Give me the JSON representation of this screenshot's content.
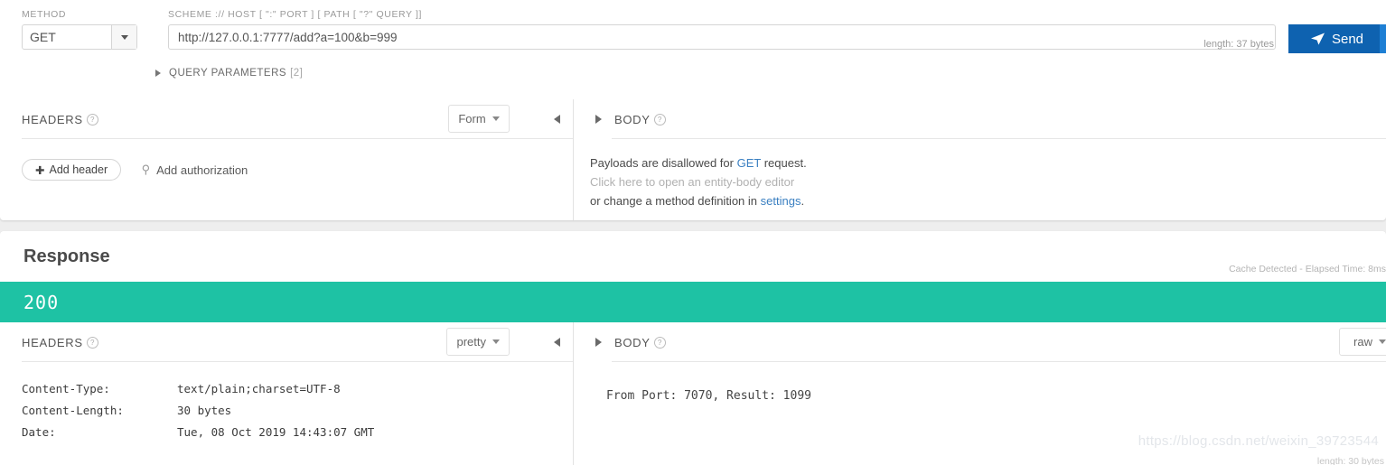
{
  "request": {
    "method_label": "METHOD",
    "method_value": "GET",
    "url_label": "SCHEME :// HOST [ \":\" PORT ] [ PATH [ \"?\" QUERY ]]",
    "url_value": "http://127.0.0.1:7777/add?a=100&b=999",
    "url_length": "length: 37 bytes",
    "query_params_label": "QUERY PARAMETERS",
    "query_params_count": "[2]",
    "send_label": "Send",
    "send_icon": "paper-plane-icon",
    "headers": {
      "title": "HEADERS",
      "help": "?",
      "format_value": "Form",
      "add_header_label": "Add header",
      "add_header_icon": "plus-icon",
      "add_authorization_label": "Add authorization",
      "add_authorization_icon": "key-icon"
    },
    "body": {
      "title": "BODY",
      "help": "?",
      "line1_a": "Payloads are disallowed for ",
      "line1_link": "GET",
      "line1_b": " request.",
      "line2": "Click here to open an entity-body editor",
      "line3_a": "or change a method definition in ",
      "line3_link": "settings",
      "line3_b": "."
    }
  },
  "response": {
    "title": "Response",
    "meta": "Cache Detected - Elapsed Time: 8ms",
    "status_code": "200",
    "status_color": "#1ec2a4",
    "headers": {
      "title": "HEADERS",
      "help": "?",
      "format_value": "pretty",
      "rows": [
        {
          "key": "Content-Type:",
          "value": "text/plain;charset=UTF-8"
        },
        {
          "key": "Content-Length:",
          "value": "30 bytes"
        },
        {
          "key": "Date:",
          "value": "Tue, 08 Oct 2019 14:43:07 GMT"
        }
      ]
    },
    "body": {
      "title": "BODY",
      "help": "?",
      "format_value": "raw",
      "content": "From Port: 7070, Result: 1099",
      "length": "length: 30 bytes"
    }
  },
  "watermark": "https://blog.csdn.net/weixin_39723544"
}
